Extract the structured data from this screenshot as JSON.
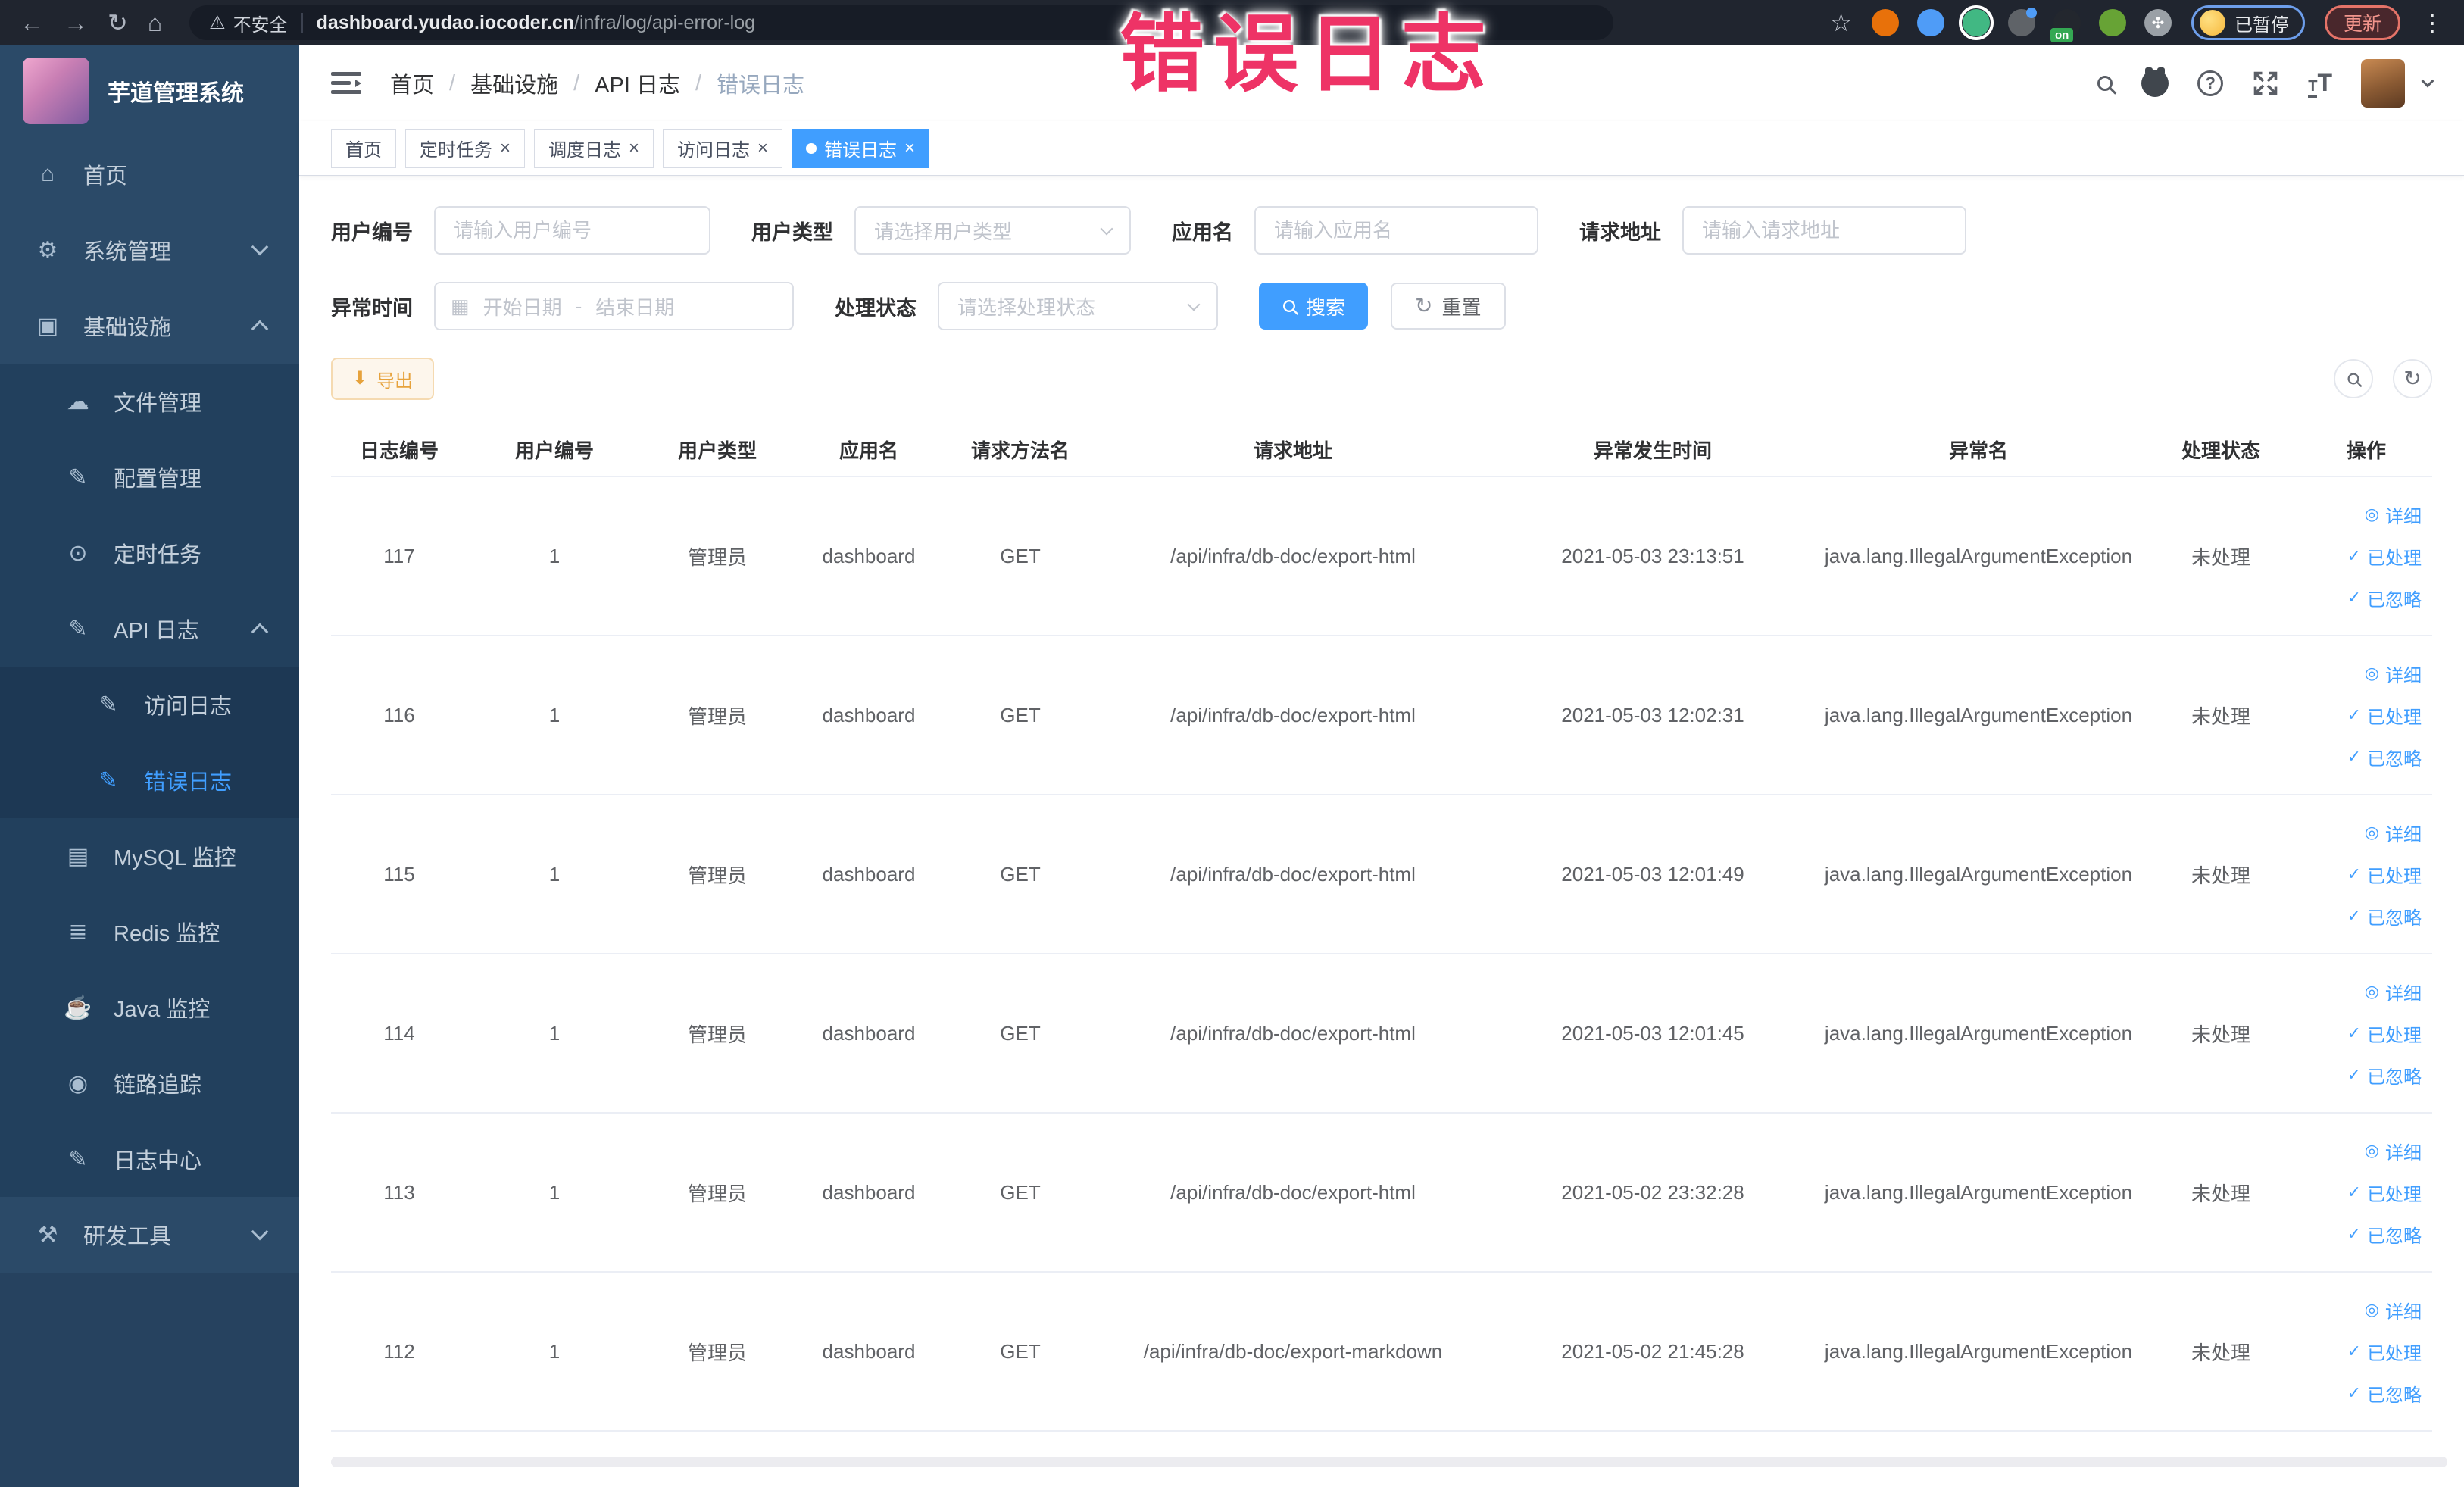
{
  "icons": {
    "home": "⌂",
    "gear": "⚙",
    "monitor": "▣",
    "cloud-upload": "☁",
    "edit": "✎",
    "timer": "⊙",
    "chart": "▤",
    "stack": "≣",
    "java": "☕",
    "eye": "◉",
    "tools": "⚒",
    "detail": "◎",
    "check": "✓",
    "warning": "⚠",
    "back": "←",
    "forward": "→",
    "reload": "↻",
    "home-browser": "⌂",
    "star": "☆",
    "kebab": "⋮",
    "calendar": "▦",
    "refresh": "↻",
    "download": "⬇",
    "puzzle": "✣",
    "close": "×",
    "question": "?"
  },
  "browser": {
    "security_label": "不安全",
    "url_domain": "dashboard.yudao.iocoder.cn",
    "url_path": "/infra/log/api-error-log",
    "paused_badge": "已暂停",
    "update_button": "更新",
    "extensions": [
      {
        "name": "ext-adblock-icon",
        "color": "#e8710a"
      },
      {
        "name": "ext-shield-icon",
        "color": "#4f9cf7"
      },
      {
        "name": "ext-vue-icon",
        "color": "#41b883",
        "ring": true
      },
      {
        "name": "ext-grid-icon",
        "color": "#5f6368",
        "dot": "#4f9cf7"
      },
      {
        "name": "ext-switch-icon",
        "color": "#23272e",
        "badge": "on",
        "badge_color": "#34a853"
      },
      {
        "name": "ext-leaf-icon",
        "color": "#67a335"
      },
      {
        "name": "extensions-puzzle-icon",
        "color": "#9aa0a6",
        "glyph": "✣"
      }
    ]
  },
  "annotation": {
    "text": "错误日志",
    "color": "#ee3366"
  },
  "sidebar": {
    "title": "芋道管理系统",
    "items": [
      {
        "key": "home",
        "label": "首页",
        "icon": "home",
        "depth": 0
      },
      {
        "key": "system",
        "label": "系统管理",
        "icon": "gear",
        "depth": 0,
        "chevron": "down"
      },
      {
        "key": "infra",
        "label": "基础设施",
        "icon": "monitor",
        "depth": 0,
        "chevron": "up"
      },
      {
        "key": "file",
        "label": "文件管理",
        "icon": "cloud-upload",
        "depth": 1
      },
      {
        "key": "config",
        "label": "配置管理",
        "icon": "edit",
        "depth": 1
      },
      {
        "key": "job",
        "label": "定时任务",
        "icon": "timer",
        "depth": 1
      },
      {
        "key": "api-log",
        "label": "API 日志",
        "icon": "edit",
        "depth": 1,
        "chevron": "up"
      },
      {
        "key": "access-log",
        "label": "访问日志",
        "icon": "edit",
        "depth": 2
      },
      {
        "key": "error-log",
        "label": "错误日志",
        "icon": "edit",
        "depth": 2,
        "active": true
      },
      {
        "key": "mysql",
        "label": "MySQL 监控",
        "icon": "chart",
        "depth": 1
      },
      {
        "key": "redis",
        "label": "Redis 监控",
        "icon": "stack",
        "depth": 1
      },
      {
        "key": "java",
        "label": "Java 监控",
        "icon": "java",
        "depth": 1
      },
      {
        "key": "trace",
        "label": "链路追踪",
        "icon": "eye",
        "depth": 1
      },
      {
        "key": "log-center",
        "label": "日志中心",
        "icon": "edit",
        "depth": 1
      },
      {
        "key": "devtools",
        "label": "研发工具",
        "icon": "tools",
        "depth": 0,
        "chevron": "down"
      }
    ]
  },
  "breadcrumb": [
    "首页",
    "基础设施",
    "API 日志",
    "错误日志"
  ],
  "tabs": [
    {
      "label": "首页"
    },
    {
      "label": "定时任务",
      "closable": true
    },
    {
      "label": "调度日志",
      "closable": true
    },
    {
      "label": "访问日志",
      "closable": true
    },
    {
      "label": "错误日志",
      "closable": true,
      "active": true
    }
  ],
  "filters": {
    "user_id": {
      "label": "用户编号",
      "placeholder": "请输入用户编号"
    },
    "user_type": {
      "label": "用户类型",
      "placeholder": "请选择用户类型"
    },
    "app_name": {
      "label": "应用名",
      "placeholder": "请输入应用名"
    },
    "request_url": {
      "label": "请求地址",
      "placeholder": "请输入请求地址"
    },
    "exception_time": {
      "label": "异常时间",
      "start_placeholder": "开始日期",
      "separator": "-",
      "end_placeholder": "结束日期"
    },
    "process_status": {
      "label": "处理状态",
      "placeholder": "请选择处理状态"
    },
    "search_button": "搜索",
    "reset_button": "重置"
  },
  "toolbar": {
    "export_label": "导出"
  },
  "table": {
    "headers": [
      "日志编号",
      "用户编号",
      "用户类型",
      "应用名",
      "请求方法名",
      "请求地址",
      "异常发生时间",
      "异常名",
      "处理状态",
      "操作"
    ],
    "actions": [
      {
        "label": "详细",
        "icon": "detail"
      },
      {
        "label": "已处理",
        "icon": "check"
      },
      {
        "label": "已忽略",
        "icon": "check"
      }
    ],
    "rows": [
      [
        "117",
        "1",
        "管理员",
        "dashboard",
        "GET",
        "/api/infra/db-doc/export-html",
        "2021-05-03 23:13:51",
        "java.lang.IllegalArgumentException",
        "未处理"
      ],
      [
        "116",
        "1",
        "管理员",
        "dashboard",
        "GET",
        "/api/infra/db-doc/export-html",
        "2021-05-03 12:02:31",
        "java.lang.IllegalArgumentException",
        "未处理"
      ],
      [
        "115",
        "1",
        "管理员",
        "dashboard",
        "GET",
        "/api/infra/db-doc/export-html",
        "2021-05-03 12:01:49",
        "java.lang.IllegalArgumentException",
        "未处理"
      ],
      [
        "114",
        "1",
        "管理员",
        "dashboard",
        "GET",
        "/api/infra/db-doc/export-html",
        "2021-05-03 12:01:45",
        "java.lang.IllegalArgumentException",
        "未处理"
      ],
      [
        "113",
        "1",
        "管理员",
        "dashboard",
        "GET",
        "/api/infra/db-doc/export-html",
        "2021-05-02 23:32:28",
        "java.lang.IllegalArgumentException",
        "未处理"
      ],
      [
        "112",
        "1",
        "管理员",
        "dashboard",
        "GET",
        "/api/infra/db-doc/export-markdown",
        "2021-05-02 21:45:28",
        "java.lang.IllegalArgumentException",
        "未处理"
      ]
    ]
  }
}
